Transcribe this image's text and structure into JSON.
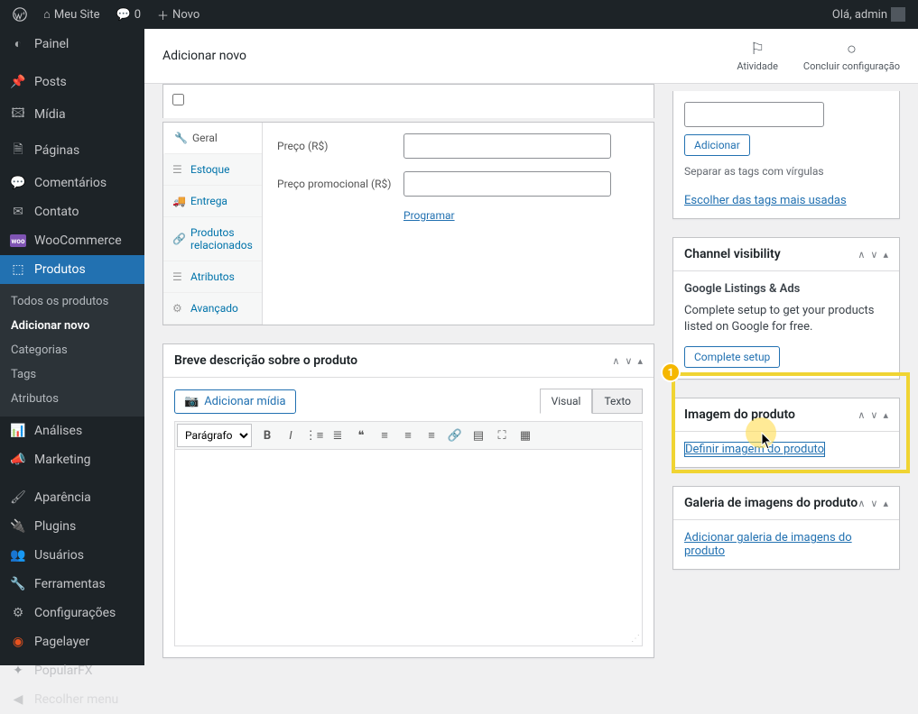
{
  "adminbar": {
    "site": "Meu Site",
    "comments": "0",
    "new": "Novo",
    "greeting": "Olá, admin"
  },
  "sidebar": {
    "dashboard": "Painel",
    "posts": "Posts",
    "media": "Mídia",
    "pages": "Páginas",
    "comments": "Comentários",
    "contact": "Contato",
    "woocommerce": "WooCommerce",
    "products": "Produtos",
    "sub": {
      "all": "Todos os produtos",
      "add": "Adicionar novo",
      "categories": "Categorias",
      "tags": "Tags",
      "attributes": "Atributos"
    },
    "analytics": "Análises",
    "marketing": "Marketing",
    "appearance": "Aparência",
    "plugins": "Plugins",
    "users": "Usuários",
    "tools": "Ferramentas",
    "settings": "Configurações",
    "pagelayer": "Pagelayer",
    "popularfx": "PopularFX",
    "collapse": "Recolher menu"
  },
  "header": {
    "title": "Adicionar novo",
    "activity": "Atividade",
    "finish": "Concluir configuração"
  },
  "pd": {
    "tabs": {
      "general": "Geral",
      "inventory": "Estoque",
      "shipping": "Entrega",
      "linked": "Produtos relacionados",
      "attributes": "Atributos",
      "advanced": "Avançado"
    },
    "price_label": "Preço (R$)",
    "sale_label": "Preço promocional (R$)",
    "schedule": "Programar"
  },
  "shortdesc": {
    "title": "Breve descrição sobre o produto",
    "add_media": "Adicionar mídia",
    "visual": "Visual",
    "text": "Texto",
    "paragraph": "Parágrafo"
  },
  "tags": {
    "add": "Adicionar",
    "sep": "Separar as tags com vírgulas",
    "choose": "Escolher das tags mais usadas"
  },
  "channel": {
    "title": "Channel visibility",
    "gla": "Google Listings & Ads",
    "desc": "Complete setup to get your products listed on Google for free.",
    "btn": "Complete setup"
  },
  "image": {
    "title": "Imagem do produto",
    "set": "Definir imagem do produto"
  },
  "gallery": {
    "title": "Galeria de imagens do produto",
    "add": "Adicionar galeria de imagens do produto"
  }
}
